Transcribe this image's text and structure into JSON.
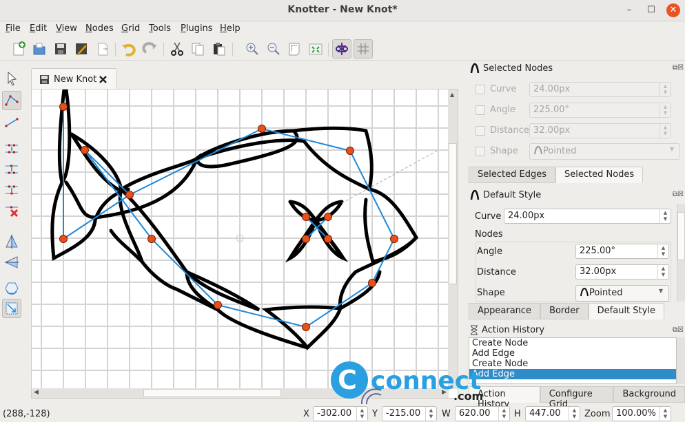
{
  "window": {
    "title": "Knotter - New Knot*"
  },
  "menu": [
    {
      "label": "File",
      "u": "F",
      "rest": "ile"
    },
    {
      "label": "Edit",
      "u": "E",
      "rest": "dit"
    },
    {
      "label": "View",
      "u": "V",
      "rest": "iew"
    },
    {
      "label": "Nodes",
      "u": "N",
      "rest": "odes"
    },
    {
      "label": "Grid",
      "u": "G",
      "rest": "rid"
    },
    {
      "label": "Tools",
      "u": "T",
      "rest": "ools"
    },
    {
      "label": "Plugins",
      "u": "P",
      "rest": "lugins"
    },
    {
      "label": "Help",
      "u": "H",
      "rest": "elp"
    }
  ],
  "toolbar": {
    "items": [
      "new-file",
      "open-file",
      "save",
      "save-as",
      "export",
      "undo",
      "redo",
      "cut",
      "copy",
      "paste",
      "zoom-in",
      "zoom-out",
      "page-size",
      "fit-view",
      "edge-display",
      "grid-toggle"
    ]
  },
  "left_tools": [
    "select",
    "edit-graph",
    "edge-chain",
    "insert-node",
    "insert-node-2",
    "insert-node-3",
    "delete-node",
    "flip-horizontal",
    "flip-vertical",
    "rotate",
    "scale"
  ],
  "document_tab": {
    "label": "New Knot"
  },
  "selected_nodes_dock": {
    "title": "Selected Nodes",
    "rows": [
      {
        "label": "Curve",
        "value": "24.00px"
      },
      {
        "label": "Angle",
        "value": "225.00°"
      },
      {
        "label": "Distance",
        "value": "32.00px"
      },
      {
        "label": "Shape",
        "value": "Pointed"
      }
    ],
    "tabs": [
      "Selected Edges",
      "Selected Nodes"
    ],
    "active_tab": "Selected Nodes"
  },
  "default_style_dock": {
    "title": "Default Style",
    "curve_label": "Curve",
    "curve_value": "24.00px",
    "nodes_label": "Nodes",
    "angle_label": "Angle",
    "angle_value": "225.00°",
    "distance_label": "Distance",
    "distance_value": "32.00px",
    "shape_label": "Shape",
    "shape_value": "Pointed",
    "tabs": [
      "Appearance",
      "Border",
      "Default Style"
    ],
    "active_tab": "Default Style"
  },
  "action_history_dock": {
    "title": "Action History",
    "items": [
      "Create Node",
      "Add Edge",
      "Create Node",
      "Add Edge"
    ],
    "selected_index": 3,
    "tabs": [
      "Action History",
      "Configure Grid",
      "Background"
    ],
    "active_tab": "Action History"
  },
  "status": {
    "cursor": "(288,-128)",
    "x_label": "X",
    "x": "-302.00",
    "y_label": "Y",
    "y": "-215.00",
    "w_label": "W",
    "w": "620.00",
    "h_label": "H",
    "h": "447.00",
    "zoom_label": "Zoom",
    "zoom": "100.00%"
  },
  "colors": {
    "accent": "#308cc6",
    "node": "#e8501a",
    "edge": "#1e88d8",
    "close": "#e95420"
  },
  "watermark": {
    "text_big": "connect",
    "text_small": ".com"
  }
}
